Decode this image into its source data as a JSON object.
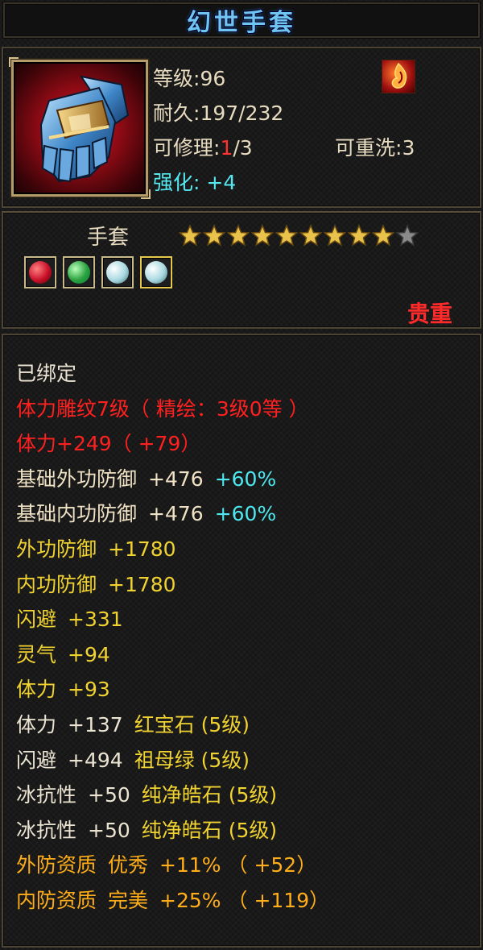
{
  "title": "幻世手套",
  "item": {
    "level_label": "等级:",
    "level_value": "96",
    "durability_label": "耐久:",
    "durability_value": "197/232",
    "repair_label": "可修理:",
    "repair_used": "1",
    "repair_total": "/3",
    "reforge_label": "可重洗:",
    "reforge_value": "3",
    "enhance_label": "强化:",
    "enhance_value": "+4"
  },
  "type": "手套",
  "stars": {
    "filled": 9,
    "total": 10
  },
  "gems": [
    "red-gem-icon",
    "green-gem-icon",
    "white-gem-icon",
    "white-gem-icon"
  ],
  "rarity": "贵重",
  "bound": "已绑定",
  "attributes": [
    {
      "a": "体力雕纹7级（ 精绘：3级0等 ）",
      "b": "",
      "c": "",
      "color": "red"
    },
    {
      "a": "体力+249（ +79）",
      "b": "",
      "c": "",
      "color": "red"
    },
    {
      "a": "基础外功防御",
      "b": "+476",
      "c": "+60%",
      "color": "beige"
    },
    {
      "a": "基础内功防御",
      "b": "+476",
      "c": "+60%",
      "color": "beige"
    },
    {
      "a": "外功防御",
      "b": "+1780",
      "c": "",
      "color": "yellow"
    },
    {
      "a": "内功防御",
      "b": "+1780",
      "c": "",
      "color": "yellow"
    },
    {
      "a": "闪避",
      "b": "+331",
      "c": "",
      "color": "yellow"
    },
    {
      "a": "灵气",
      "b": "+94",
      "c": "",
      "color": "yellow"
    },
    {
      "a": "体力",
      "b": "+93",
      "c": "",
      "color": "yellow"
    },
    {
      "a": "体力",
      "b": "+137",
      "c": "红宝石 (5级)",
      "color": "white-yellow"
    },
    {
      "a": "闪避",
      "b": "+494",
      "c": "祖母绿 (5级)",
      "color": "white-yellow"
    },
    {
      "a": "冰抗性",
      "b": "+50",
      "c": "纯净皓石 (5级)",
      "color": "white-yellow"
    },
    {
      "a": "冰抗性",
      "b": "+50",
      "c": "纯净皓石 (5级)",
      "color": "white-yellow"
    },
    {
      "a": "外防资质",
      "b": "优秀",
      "c": "+11% （ +52）",
      "color": "orange"
    },
    {
      "a": "内防资质",
      "b": "完美",
      "c": "+25% （ +119）",
      "color": "orange"
    }
  ],
  "colors": {
    "title": "#6fc4f0",
    "red": "#ff2020",
    "yellow": "#f0d230",
    "orange": "#ffae1a",
    "cyan": "#4ee8f0",
    "beige": "#f0e2c4"
  }
}
